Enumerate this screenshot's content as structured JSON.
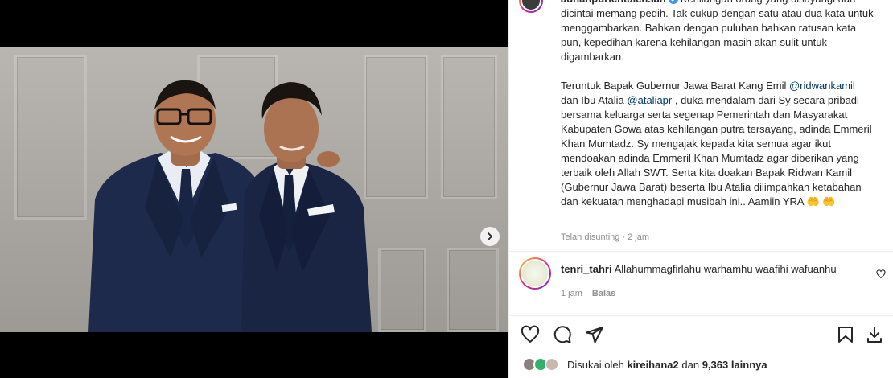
{
  "post": {
    "owner": {
      "username": "adnanpurichtaichsan",
      "verified": true,
      "avatar_icon": "profile-avatar"
    },
    "caption_paragraphs": [
      [
        {
          "text": "Kehilangan orang yang disayangi dan dicintai memang pedih. Tak cukup dengan satu atau dua kata untuk menggambarkan. Bahkan dengan puluhan bahkan ratusan kata pun, kepedihan karena kehilangan masih akan sulit untuk digambarkan."
        }
      ],
      [
        {
          "text": "Teruntuk Bapak Gubernur Jawa Barat Kang Emil "
        },
        {
          "text": "@ridwankamil",
          "mention": true
        },
        {
          "text": " dan Ibu Atalia "
        },
        {
          "text": "@ataliapr",
          "mention": true
        },
        {
          "text": " , duka mendalam dari Sy secara pribadi bersama keluarga serta segenap Pemerintah dan Masyarakat Kabupaten Gowa atas kehilangan putra tersayang, adinda Emmeril Khan Mumtadz. Sy mengajak kepada kita semua agar ikut mendoakan adinda Emmeril Khan Mumtadz agar diberikan yang terbaik oleh Allah SWT. Serta kita doakan Bapak Ridwan Kamil (Gubernur Jawa Barat) beserta Ibu Atalia dilimpahkan ketabahan dan kekuatan menghadapi musibah ini.. Aamiin YRA 🤲 🤲"
        }
      ]
    ],
    "edited_label": "Telah disunting · 2 jam",
    "carousel": {
      "slide_count": 2,
      "active_index": 0,
      "next_icon": "chevron-right-icon"
    },
    "comment": {
      "username": "tenri_tahri",
      "text": "Allahummagfirlahu warhamhu waafihi wafuanhu",
      "time": "1 jam",
      "reply_label": "Balas",
      "like_icon": "heart-outline-icon"
    },
    "actions": {
      "like_icon": "heart-outline-icon",
      "comment_icon": "comment-bubble-icon",
      "share_icon": "paper-plane-icon",
      "save_icon": "bookmark-icon",
      "download_icon": "download-icon"
    },
    "likes": {
      "prefix": "Disukai oleh ",
      "first_liker": "kireihana2",
      "connector": " dan ",
      "others": "9,363 lainnya"
    }
  },
  "colors": {
    "text": "#262626",
    "secondary_text": "#8e8e8e",
    "mention": "#00376b",
    "verified_badge": "#3897f0",
    "suit_navy": "#1d2a4b",
    "wall_grey": "#aeaaa5"
  }
}
